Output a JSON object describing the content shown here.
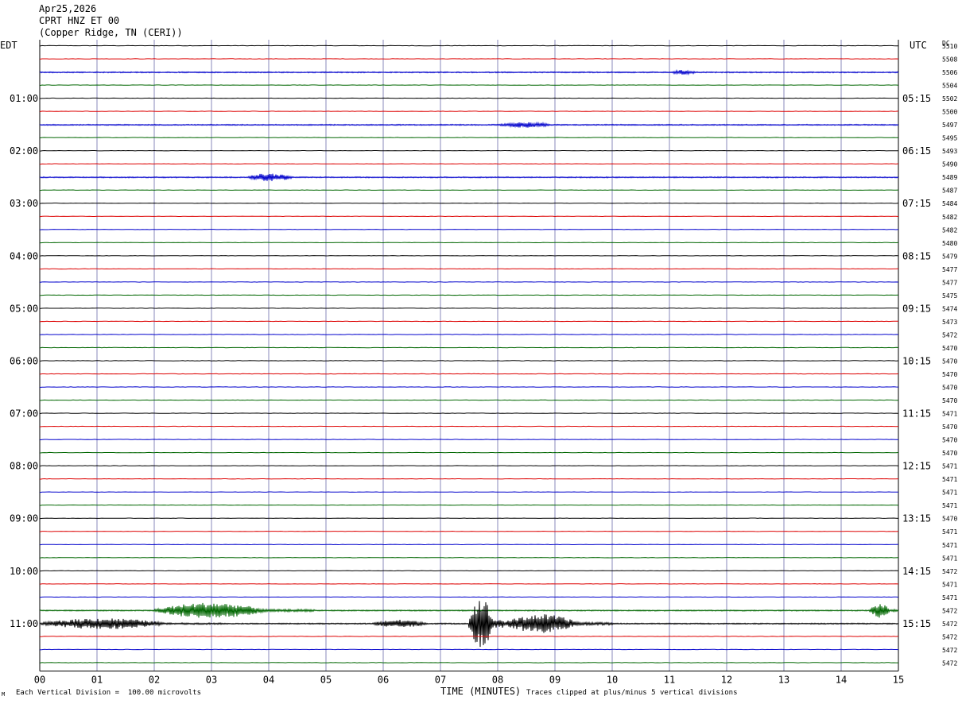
{
  "header": {
    "date": "Apr25,2026",
    "station": "CPRT HNZ ET 00",
    "location": "(Copper Ridge, TN (CERI))"
  },
  "left_tz": "EDT",
  "right_tz": "UTC",
  "dc_label": "DC",
  "footer": {
    "scale": "Each Vertical Division =  100.00 microvolts",
    "xlabel": "TIME (MINUTES)",
    "clip": "Traces clipped at plus/minus 5 vertical divisions"
  },
  "colors": {
    "black": "#000000",
    "red": "#dd0000",
    "blue": "#0000cc",
    "green": "#006600",
    "grid": "#8888bb"
  },
  "chart_data": {
    "type": "line",
    "xlabel": "TIME (MINUTES)",
    "xlim": [
      0,
      15
    ],
    "x_ticks": [
      "00",
      "01",
      "02",
      "03",
      "04",
      "05",
      "06",
      "07",
      "08",
      "09",
      "10",
      "11",
      "12",
      "13",
      "14",
      "15"
    ],
    "left_hour_labels": [
      "01:00",
      "02:00",
      "03:00",
      "04:00",
      "05:00",
      "06:00",
      "07:00",
      "08:00",
      "09:00",
      "10:00",
      "11:00"
    ],
    "right_hour_labels": [
      "05:15",
      "06:15",
      "07:15",
      "08:15",
      "09:15",
      "10:15",
      "11:15",
      "12:15",
      "13:15",
      "14:15",
      "15:15"
    ],
    "dc_values": [
      "5510",
      "5508",
      "5506",
      "5504",
      "5502",
      "5500",
      "5497",
      "5495",
      "5493",
      "5490",
      "5489",
      "5487",
      "5484",
      "5482",
      "5482",
      "5480",
      "5479",
      "5477",
      "5477",
      "5475",
      "5474",
      "5473",
      "5472",
      "5470",
      "5470",
      "5470",
      "5470",
      "5470",
      "5471",
      "5470",
      "5470",
      "5470",
      "5471",
      "5471",
      "5471",
      "5471",
      "5470",
      "5471",
      "5471",
      "5471",
      "5472",
      "5471",
      "5471",
      "5472",
      "5472",
      "5472",
      "5472",
      "5472"
    ],
    "trace_color_cycle": [
      "black",
      "red",
      "blue",
      "green"
    ],
    "events": [
      {
        "trace": 2,
        "start_min": 11.0,
        "end_min": 11.7,
        "amp": 3
      },
      {
        "trace": 6,
        "start_min": 8.0,
        "end_min": 9.4,
        "amp": 3.5
      },
      {
        "trace": 10,
        "start_min": 3.6,
        "end_min": 4.8,
        "amp": 5
      },
      {
        "trace": 43,
        "start_min": 2.0,
        "end_min": 4.8,
        "amp": 10
      },
      {
        "trace": 43,
        "start_min": 14.5,
        "end_min": 15.0,
        "amp": 9
      },
      {
        "trace": 44,
        "start_min": 0.0,
        "end_min": 3.2,
        "amp": 7
      },
      {
        "trace": 44,
        "start_min": 5.8,
        "end_min": 7.2,
        "amp": 5
      },
      {
        "trace": 44,
        "start_min": 7.5,
        "end_min": 8.1,
        "amp": 34
      },
      {
        "trace": 44,
        "start_min": 8.1,
        "end_min": 10.0,
        "amp": 12
      }
    ]
  }
}
